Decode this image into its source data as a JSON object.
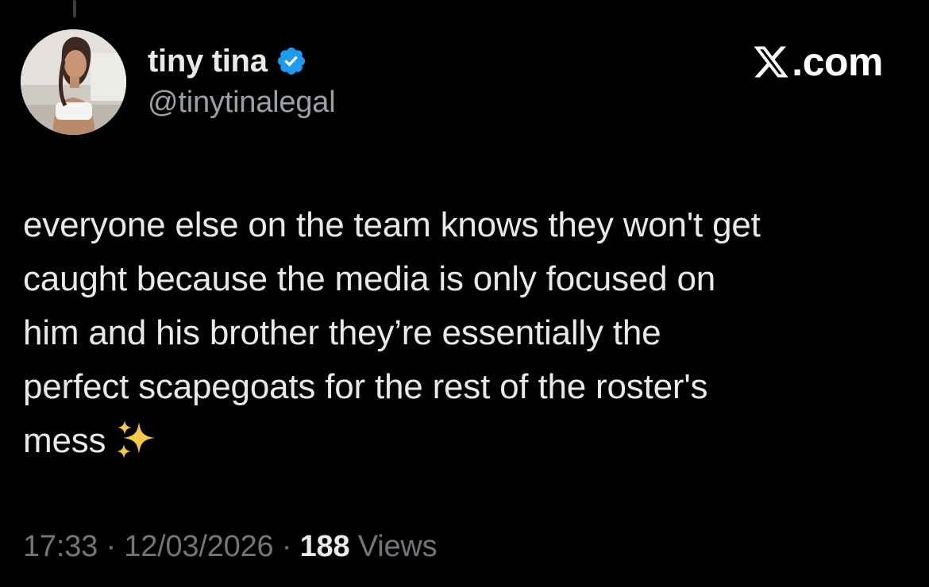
{
  "post": {
    "author": {
      "display_name": "tiny tina",
      "handle": "@tinytinalegal",
      "verified": true,
      "avatar_icon": "profile-photo"
    },
    "brand": {
      "icon": "x-logo-icon",
      "text": ".com"
    },
    "text": "everyone else on the team knows they won't get\ncaught because the media is only focused on\nhim and his brother they’re essentially the\nperfect scapegoats for the rest of the roster's\nmess",
    "emoji": "sparkles-icon",
    "meta": {
      "time": "17:33",
      "separator": " · ",
      "date": "12/03/2026",
      "views_count": "188",
      "views_label": " Views"
    }
  },
  "colors": {
    "background": "#000000",
    "primary_text": "#e7e9ea",
    "secondary_text": "#71767b",
    "verified_blue": "#1d9bf0",
    "sparkle_gold": "#f7c948"
  }
}
